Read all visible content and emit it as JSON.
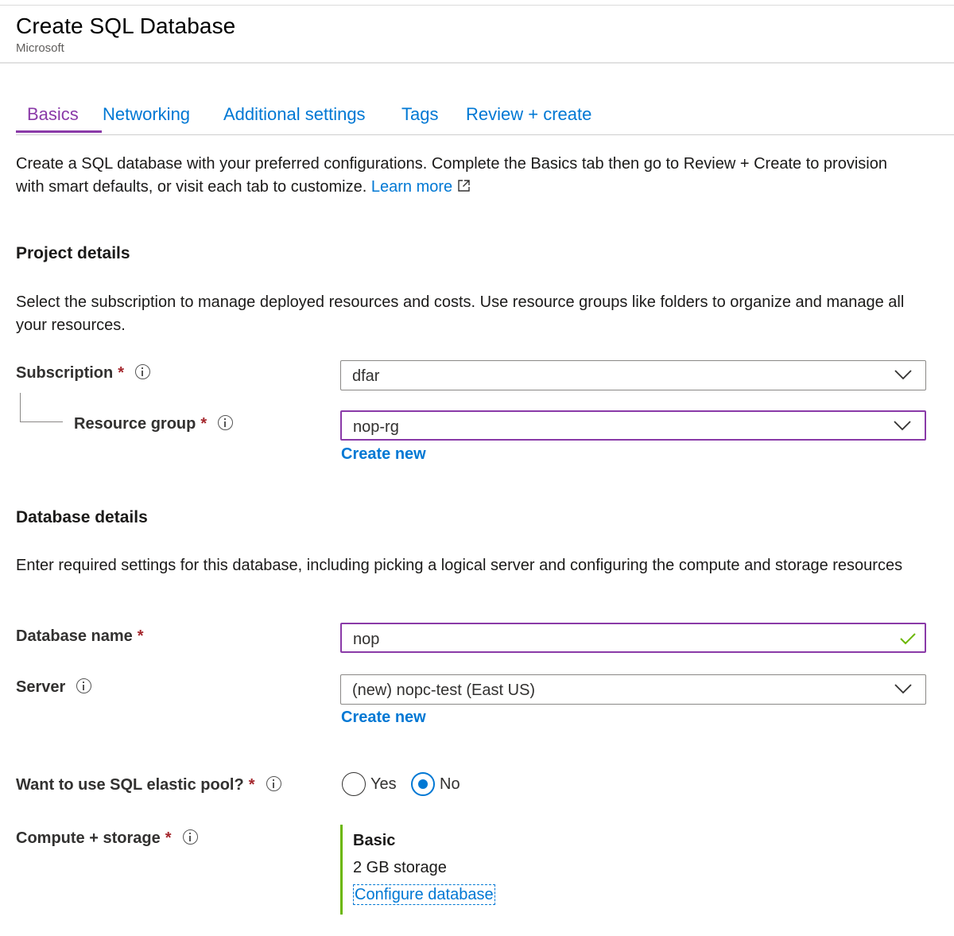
{
  "header": {
    "title": "Create SQL Database",
    "publisher": "Microsoft"
  },
  "tabs": [
    {
      "label": "Basics",
      "active": true
    },
    {
      "label": "Networking",
      "active": false
    },
    {
      "label": "Additional settings",
      "active": false
    },
    {
      "label": "Tags",
      "active": false
    },
    {
      "label": "Review + create",
      "active": false
    }
  ],
  "intro": {
    "text": "Create a SQL database with your preferred configurations. Complete the Basics tab then go to Review + Create to provision with smart defaults, or visit each tab to customize.",
    "learn_more": "Learn more"
  },
  "project": {
    "title": "Project details",
    "description": "Select the subscription to manage deployed resources and costs. Use resource groups like folders to organize and manage all your resources.",
    "subscription": {
      "label": "Subscription",
      "required": "*",
      "value": "dfar"
    },
    "resource_group": {
      "label": "Resource group",
      "required": "*",
      "value": "nop-rg",
      "create_new": "Create new"
    }
  },
  "database": {
    "title": "Database details",
    "description": "Enter required settings for this database, including picking a logical server and configuring the compute and storage resources",
    "name": {
      "label": "Database name",
      "required": "*",
      "value": "nop",
      "valid": true
    },
    "server": {
      "label": "Server",
      "value": "(new) nopc-test (East US)",
      "create_new": "Create new"
    },
    "elastic_pool": {
      "label": "Want to use SQL elastic pool?",
      "required": "*",
      "options": [
        "Yes",
        "No"
      ],
      "selected": "No"
    },
    "compute": {
      "label": "Compute + storage",
      "required": "*",
      "tier": "Basic",
      "storage": "2 GB storage",
      "configure": "Configure database"
    }
  },
  "colors": {
    "accent": "#8a3aa8",
    "link": "#0078d4",
    "required": "#a4262c",
    "valid": "#6bb700"
  }
}
